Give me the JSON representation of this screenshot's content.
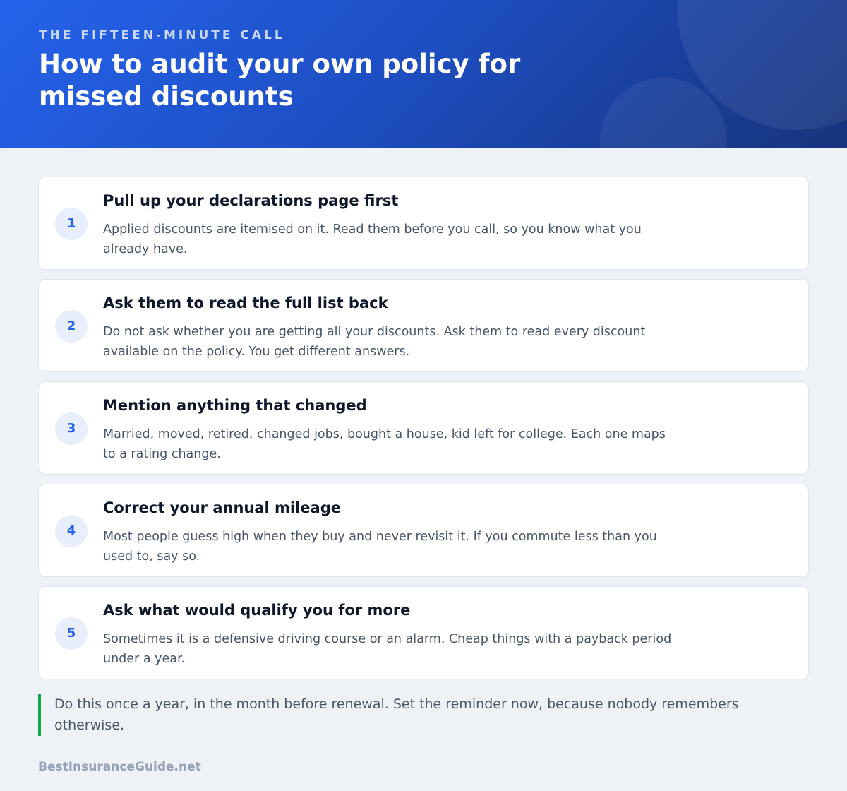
{
  "header": {
    "eyebrow": "THE FIFTEEN-MINUTE CALL",
    "title": "How to audit your own policy for missed discounts"
  },
  "steps": [
    {
      "number": "1",
      "title": "Pull up your declarations page first",
      "body": "Applied discounts are itemised on it. Read them before you call, so you know what you already have."
    },
    {
      "number": "2",
      "title": "Ask them to read the full list back",
      "body": "Do not ask whether you are getting all your discounts. Ask them to read every discount available on the policy. You get different answers."
    },
    {
      "number": "3",
      "title": "Mention anything that changed",
      "body": "Married, moved, retired, changed jobs, bought a house, kid left for college. Each one maps to a rating change."
    },
    {
      "number": "4",
      "title": "Correct your annual mileage",
      "body": "Most people guess high when they buy and never revisit it. If you commute less than you used to, say so."
    },
    {
      "number": "5",
      "title": "Ask what would qualify you for more",
      "body": "Sometimes it is a defensive driving course or an alarm. Cheap things with a payback period under a year."
    }
  ],
  "note": "Do this once a year, in the month before renewal. Set the reminder now, because nobody remembers otherwise.",
  "footer": "BestInsuranceGuide.net",
  "colors": {
    "accent": "#2563eb",
    "note_bar": "#16a34a",
    "header_dark": "#17337c"
  }
}
